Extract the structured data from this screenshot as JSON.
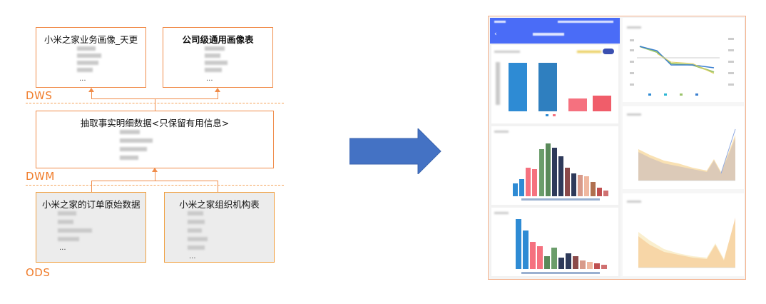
{
  "left_diagram": {
    "top_boxes": [
      {
        "title": "小米之家业务画像_天更",
        "ellipsis": "..."
      },
      {
        "title": "公司级通用画像表",
        "ellipsis": "..."
      }
    ],
    "layers": [
      "DWS",
      "DWM",
      "ODS"
    ],
    "middle_box": {
      "title": "抽取事实明细数据<只保留有用信息>"
    },
    "bottom_boxes": [
      {
        "title": "小米之家的订单原始数据",
        "ellipsis": "..."
      },
      {
        "title": "小米之家组织机构表",
        "ellipsis": "..."
      }
    ]
  },
  "arrow": {
    "color": "#4472c4"
  },
  "colors": {
    "accent": "#f08c4a",
    "layer_text": "#f07c2a",
    "arrow": "#4472c4",
    "phone_header": "#4a6cf7"
  }
}
